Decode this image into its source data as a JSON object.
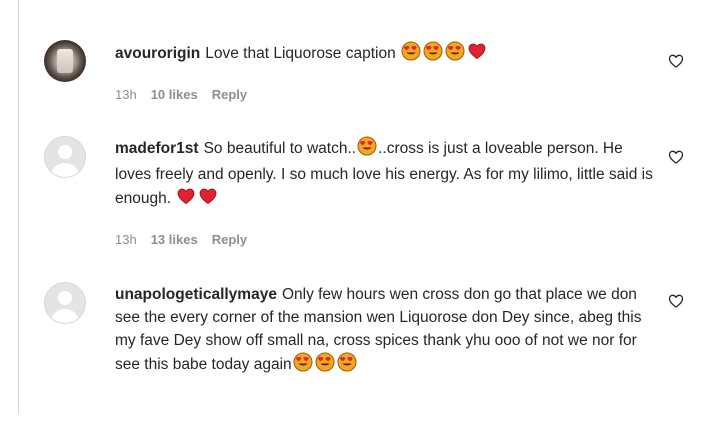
{
  "comments": [
    {
      "username": "avourorigin",
      "text": "Love that Liquorose caption",
      "time": "13h",
      "likes": "10 likes",
      "reply": "Reply",
      "emojis": [
        "heart-eyes-icon",
        "heart-eyes-icon",
        "heart-eyes-icon",
        "red-heart-icon"
      ]
    },
    {
      "username": "madefor1st",
      "text_part1": "So beautiful to watch..",
      "text_part2": "..cross is just a loveable person. He loves freely and openly. I so much love his energy. As for my lilimo, little said is enough.",
      "time": "13h",
      "likes": "13 likes",
      "reply": "Reply",
      "emojis": [
        "heart-eyes-icon",
        "red-heart-icon",
        "red-heart-icon"
      ]
    },
    {
      "username": "unapologeticallymaye",
      "text": "Only few hours wen cross don go that place we don see the every corner of the mansion wen Liquorose don Dey since, abeg this my fave Dey show off small na, cross spices thank yhu ooo of not we nor for see this babe today again",
      "emojis": [
        "heart-eyes-icon",
        "heart-eyes-icon",
        "heart-eyes-icon"
      ]
    }
  ],
  "colors": {
    "text": "#262626",
    "meta": "#8e8e8e",
    "heart_red": "#e0212f",
    "emoji_face": "#f5a623",
    "emoji_heart_eyes": "#e8222e"
  }
}
